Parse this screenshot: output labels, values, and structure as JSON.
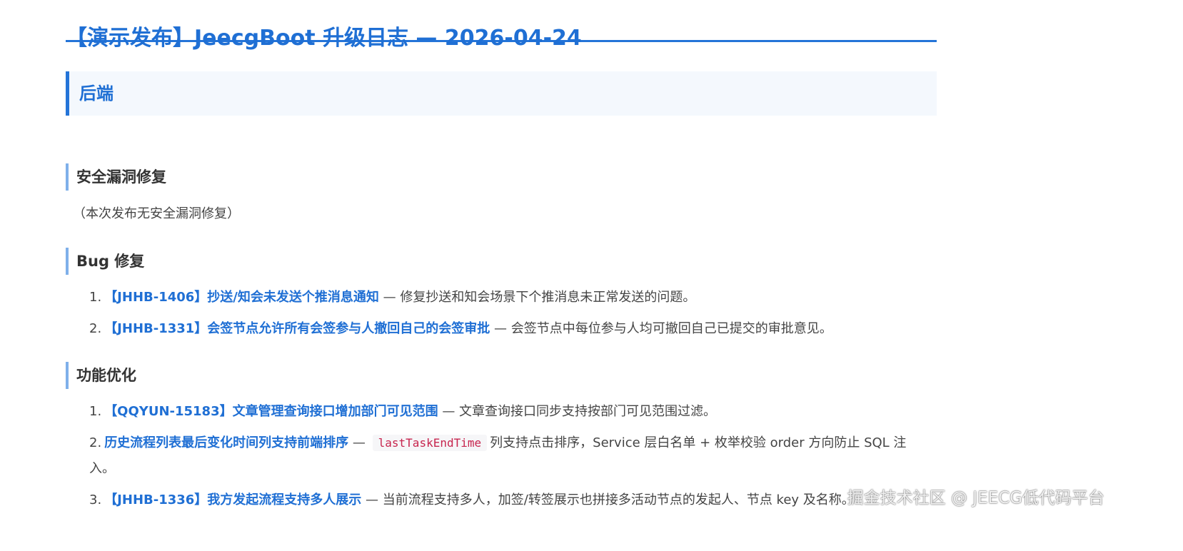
{
  "doc": {
    "title": "【演示发布】JeecgBoot 升级日志 — 2026-04-24",
    "section_backend": "后端",
    "security": {
      "heading": "安全漏洞修复",
      "note": "（本次发布无安全漏洞修复）"
    },
    "bugfix": {
      "heading": "Bug 修复",
      "items": [
        {
          "num": "1.",
          "title": "【JHHB-1406】抄送/知会未发送个推消息通知",
          "desc": " — 修复抄送和知会场景下个推消息未正常发送的问题。"
        },
        {
          "num": "2.",
          "title": "【JHHB-1331】会签节点允许所有会签参与人撤回自己的会签审批",
          "desc": " — 会签节点中每位参与人均可撤回自己已提交的审批意见。"
        }
      ]
    },
    "optimization": {
      "heading": "功能优化",
      "items": [
        {
          "num": "1.",
          "title": "【QQYUN-15183】文章管理查询接口增加部门可见范围",
          "desc": " — 文章查询接口同步支持按部门可见范围过滤。"
        },
        {
          "num": "2.",
          "title": "历史流程列表最后变化时间列支持前端排序",
          "desc_pre": " — ",
          "code": "lastTaskEndTime",
          "desc": "列支持点击排序，Service 层白名单 + 枚举校验 order 方向防止 SQL 注入。"
        },
        {
          "num": "3.",
          "title": "【JHHB-1336】我方发起流程支持多人展示",
          "desc": " — 当前流程支持多人，加签/转签展示也拼接多活动节点的发起人、节点 key 及名称。"
        }
      ]
    }
  },
  "watermark": "掘金技术社区 @ JEECG低代码平台"
}
